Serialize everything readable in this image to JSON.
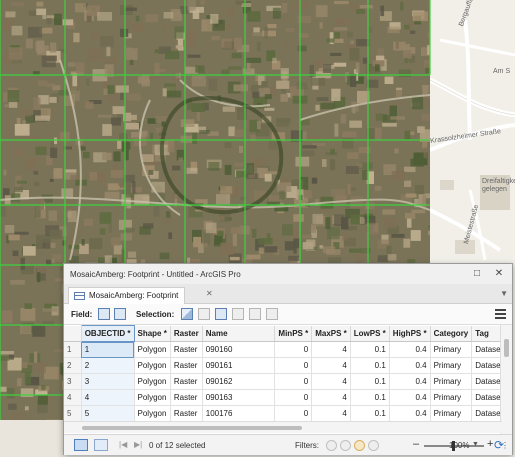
{
  "map": {
    "street_labels": [
      "Bergauffahrt",
      "Am S",
      "Krassolzheimer Straße",
      "Dreifaltigkeit gelegen",
      "Meistestraße"
    ]
  },
  "window": {
    "title": "MosaicAmberg: Footprint - Untitled - ArcGIS Pro",
    "tab_label": "MosaicAmberg: Footprint"
  },
  "toolbar": {
    "field_label": "Field:",
    "selection_label": "Selection:"
  },
  "table": {
    "columns": [
      "OBJECTID *",
      "Shape *",
      "Raster",
      "Name",
      "MinPS *",
      "MaxPS *",
      "LowPS *",
      "HighPS *",
      "Category",
      "Tag"
    ],
    "rows": [
      [
        "1",
        "1",
        "Polygon",
        "Raster",
        "090160",
        "0",
        "4",
        "0.1",
        "0.4",
        "Primary",
        "Dataset"
      ],
      [
        "2",
        "2",
        "Polygon",
        "Raster",
        "090161",
        "0",
        "4",
        "0.1",
        "0.4",
        "Primary",
        "Dataset"
      ],
      [
        "3",
        "3",
        "Polygon",
        "Raster",
        "090162",
        "0",
        "4",
        "0.1",
        "0.4",
        "Primary",
        "Dataset"
      ],
      [
        "4",
        "4",
        "Polygon",
        "Raster",
        "090163",
        "0",
        "4",
        "0.1",
        "0.4",
        "Primary",
        "Dataset"
      ],
      [
        "5",
        "5",
        "Polygon",
        "Raster",
        "100176",
        "0",
        "4",
        "0.1",
        "0.4",
        "Primary",
        "Dataset"
      ]
    ]
  },
  "status": {
    "selected_text": "0 of 12 selected",
    "filters_label": "Filters:",
    "zoom_level": "100%"
  },
  "colors": {
    "footprint_outline": "#3fd13f",
    "selection_blue": "#6a95c7",
    "refresh_blue": "#2f74c0"
  }
}
